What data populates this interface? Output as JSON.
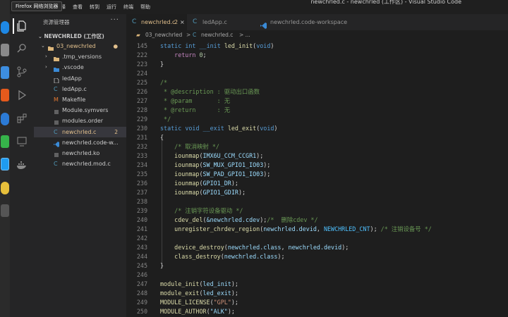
{
  "window": {
    "title": "newchrled.c - newchrled (工作区) - Visual Studio Code",
    "tooltip": "Firefox 网络浏览器"
  },
  "menu": [
    "运行",
    "选择",
    "查看",
    "转到",
    "运行",
    "终端",
    "帮助"
  ],
  "explorer": {
    "header": "资源管理器",
    "more": "···",
    "project": "NEWCHRLED (工作区)",
    "items": [
      {
        "label": "03_newchrled",
        "badge": "",
        "status": "dot"
      },
      {
        "label": ".tmp_versions",
        "badge": ""
      },
      {
        "label": ".vscode",
        "badge": ""
      },
      {
        "label": "ledApp",
        "badge": ""
      },
      {
        "label": "ledApp.c",
        "badge": ""
      },
      {
        "label": "Makefile",
        "badge": ""
      },
      {
        "label": "Module.symvers",
        "badge": ""
      },
      {
        "label": "modules.order",
        "badge": ""
      },
      {
        "label": "newchrled.c",
        "badge": "2"
      },
      {
        "label": "newchrled.code-w...",
        "badge": ""
      },
      {
        "label": "newchrled.ko",
        "badge": ""
      },
      {
        "label": "newchrled.mod.c",
        "badge": ""
      }
    ]
  },
  "tabs": [
    {
      "label": "newchrled.c",
      "badge": "2",
      "close": "×"
    },
    {
      "label": "ledApp.c",
      "badge": "",
      "close": ""
    },
    {
      "label": "newchrled.code-workspace",
      "badge": "",
      "close": ""
    }
  ],
  "breadcrumb": {
    "folder": "03_newchrled",
    "sep1": ">",
    "file": "newchrled.c",
    "sep2": "> ..."
  },
  "editor": {
    "line_numbers": [
      "145",
      "222",
      "223",
      "224",
      "225",
      "226",
      "227",
      "228",
      "229",
      "230",
      "231",
      "232",
      "233",
      "234",
      "235",
      "236",
      "237",
      "238",
      "239",
      "240",
      "241",
      "242",
      "243",
      "244",
      "245",
      "246",
      "247",
      "248",
      "249",
      "250"
    ],
    "lines": [
      {
        "type": "sticky",
        "kw1": "static",
        "kw2": "int",
        "kw3": "__init",
        "fn": "led_init",
        "p1": "(",
        "pv": "void",
        "p2": ")"
      },
      {
        "type": "return",
        "kw": "return",
        "num": "0",
        "tail": ";"
      },
      {
        "type": "plain",
        "text": "}"
      },
      {
        "type": "blank"
      },
      {
        "type": "comment",
        "text": "/*"
      },
      {
        "type": "comment",
        "text": " * @description : 驱动出口函数"
      },
      {
        "type": "comment",
        "text": " * @param       : 无"
      },
      {
        "type": "comment",
        "text": " * @return      : 无"
      },
      {
        "type": "comment",
        "text": " */"
      },
      {
        "type": "sticky",
        "kw1": "static",
        "kw2": "void",
        "kw3": "__exit",
        "fn": "led_exit",
        "p1": "(",
        "pv": "void",
        "p2": ")"
      },
      {
        "type": "plain",
        "text": "{"
      },
      {
        "type": "comment_in",
        "text": "/* 取消映射 */"
      },
      {
        "type": "call",
        "fn": "iounmap",
        "arg": "IMX6U_CCM_CCGR1"
      },
      {
        "type": "call",
        "fn": "iounmap",
        "arg": "SW_MUX_GPIO1_IO03"
      },
      {
        "type": "call",
        "fn": "iounmap",
        "arg": "SW_PAD_GPIO1_IO03"
      },
      {
        "type": "call",
        "fn": "iounmap",
        "arg": "GPIO1_DR"
      },
      {
        "type": "call",
        "fn": "iounmap",
        "arg": "GPIO1_GDIR"
      },
      {
        "type": "blank"
      },
      {
        "type": "comment_in",
        "text": "/* 注销字符设备驱动 */"
      },
      {
        "type": "cdev",
        "fn": "cdev_del",
        "arg": "&newchrled.cdev",
        "tail": ");",
        "cmt": "/*  删除cdev */"
      },
      {
        "type": "unreg",
        "fn": "unregister_chrdev_region",
        "a1": "newchrled.devid",
        "a2": "NEWCHRLED_CNT",
        "cmt": "/* 注销设备号 */"
      },
      {
        "type": "blank"
      },
      {
        "type": "call2",
        "fn": "device_destroy",
        "a1": "newchrled.class",
        "a2": "newchrled.devid"
      },
      {
        "type": "call",
        "fn": "class_destroy",
        "arg": "newchrled.class"
      },
      {
        "type": "plain",
        "text": "}"
      },
      {
        "type": "blank"
      },
      {
        "type": "macro",
        "fn": "module_init",
        "arg": "led_init"
      },
      {
        "type": "macro",
        "fn": "module_exit",
        "arg": "led_exit"
      },
      {
        "type": "license",
        "fn": "MODULE_LICENSE",
        "arg": "\"GPL\""
      },
      {
        "type": "macro",
        "fn": "MODULE_AUTHOR",
        "arg": "\"ALK\""
      }
    ]
  }
}
